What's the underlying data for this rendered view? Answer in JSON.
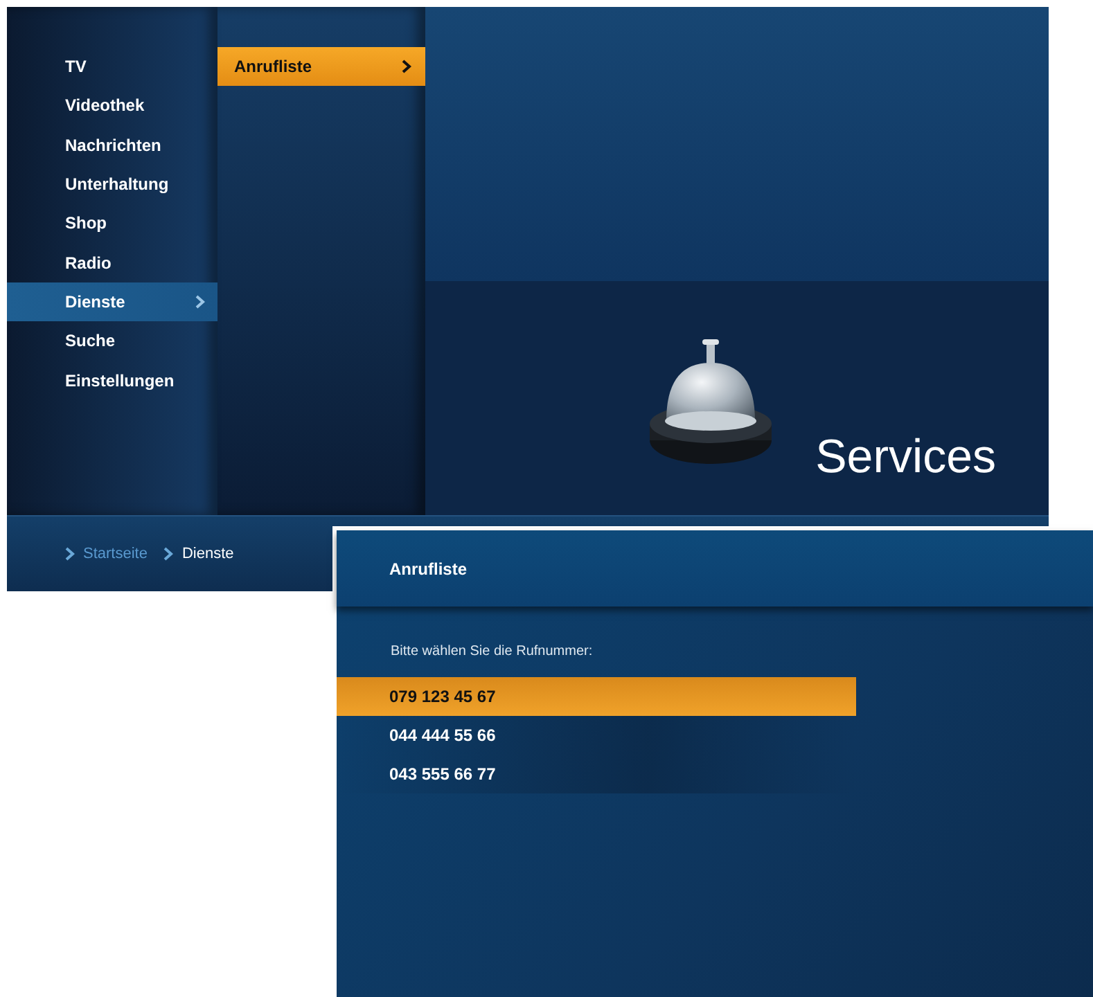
{
  "main_screen": {
    "menu": [
      {
        "label": "TV",
        "selected": false
      },
      {
        "label": "Videothek",
        "selected": false
      },
      {
        "label": "Nachrichten",
        "selected": false
      },
      {
        "label": "Unterhaltung",
        "selected": false
      },
      {
        "label": "Shop",
        "selected": false
      },
      {
        "label": "Radio",
        "selected": false
      },
      {
        "label": "Dienste",
        "selected": true
      },
      {
        "label": "Suche",
        "selected": false
      },
      {
        "label": "Einstellungen",
        "selected": false
      }
    ],
    "submenu": [
      {
        "label": "Anrufliste",
        "selected": true
      }
    ],
    "section_title": "Services",
    "breadcrumb": [
      {
        "label": "Startseite",
        "current": false
      },
      {
        "label": "Dienste",
        "current": true
      }
    ]
  },
  "call_list_screen": {
    "title": "Anrufliste",
    "prompt": "Bitte wählen Sie die Rufnummer:",
    "numbers": [
      {
        "label": "079 123 45 67",
        "selected": true
      },
      {
        "label": "044 444 55 66",
        "selected": false
      },
      {
        "label": "043 555 66 77",
        "selected": false
      }
    ]
  }
}
